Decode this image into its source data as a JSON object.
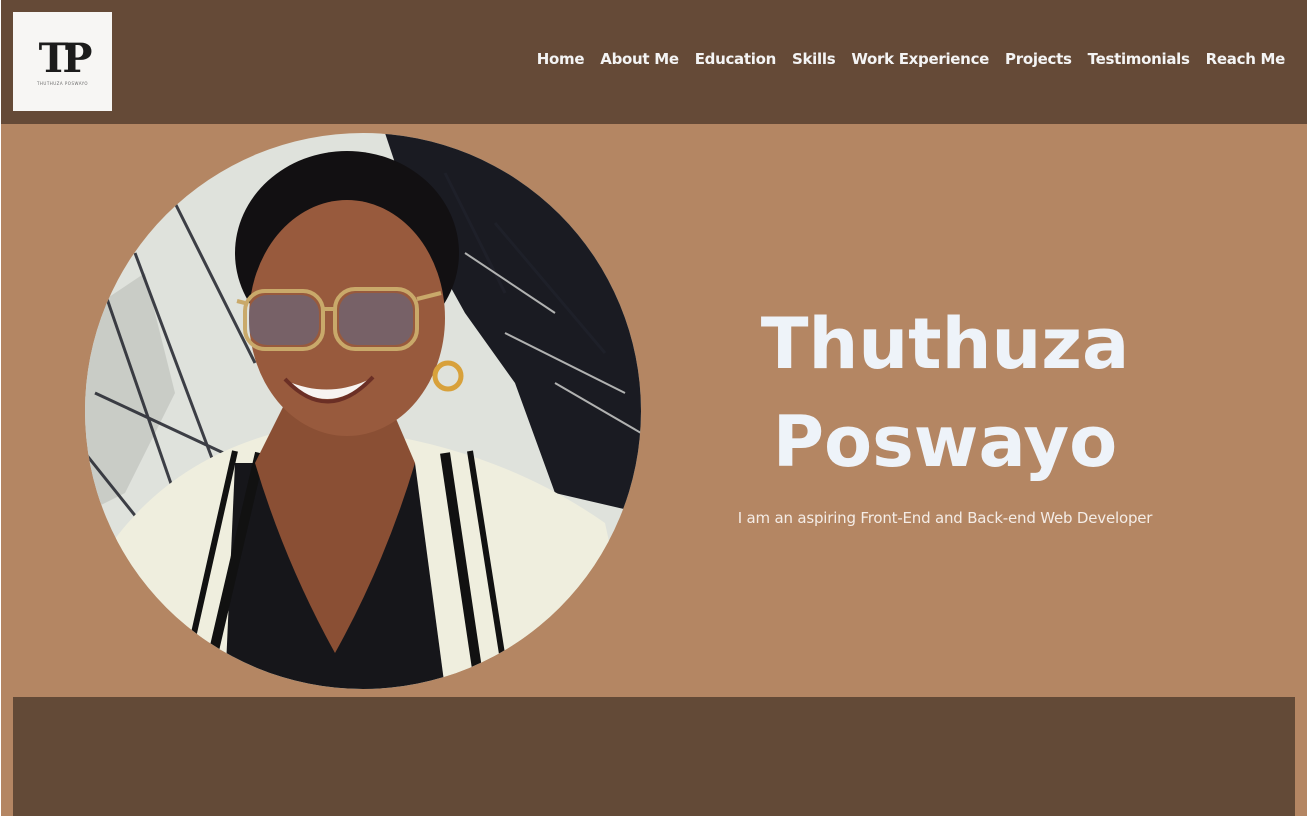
{
  "brand": {
    "logo_mark": "TP",
    "logo_subtext": "THUTHUZA POSWAYO"
  },
  "nav": {
    "items": [
      {
        "label": "Home"
      },
      {
        "label": "About Me"
      },
      {
        "label": "Education"
      },
      {
        "label": "Skills"
      },
      {
        "label": "Work Experience"
      },
      {
        "label": "Projects"
      },
      {
        "label": "Testimonials"
      },
      {
        "label": "Reach Me"
      }
    ]
  },
  "hero": {
    "first_name": "Thuthuza",
    "last_name": "Poswayo",
    "tagline": "I am an aspiring Front-End and Back-end Web Developer"
  },
  "colors": {
    "header_bg": "#654a37",
    "hero_bg": "#b48663",
    "panel_bg": "#634a37",
    "name_text": "#eef3f9"
  }
}
